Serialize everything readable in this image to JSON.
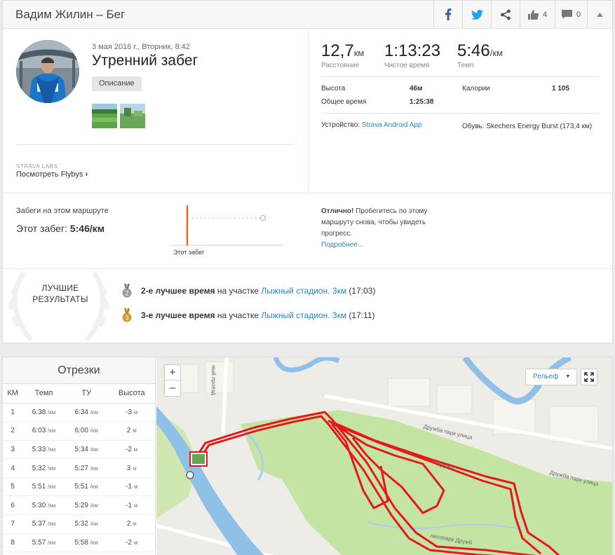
{
  "header": {
    "title": "Вадим Жилин – Бег",
    "kudos_count": "4",
    "comments_count": "0",
    "icons": [
      "facebook-icon",
      "twitter-icon",
      "share-icon",
      "thumbs-up-icon",
      "comment-icon",
      "chevron-up-icon"
    ]
  },
  "activity": {
    "date": "3 мая 2016 г., Вторник, 8:42",
    "title": "Утренний забег",
    "description_button": "Описание",
    "strava_labs": "STRAVA LABS",
    "flybys_link": "Посмотреть Flybys"
  },
  "stats": {
    "distance": {
      "value": "12,7",
      "unit": "км",
      "label": "Расстояние"
    },
    "moving_time": {
      "value": "1:13:23",
      "label": "Чистое время"
    },
    "pace": {
      "value": "5:46",
      "unit": "/км",
      "label": "Темп"
    },
    "elevation_label": "Высота",
    "elevation_value": "46м",
    "calories_label": "Калории",
    "calories_value": "1 105",
    "elapsed_label": "Общее время",
    "elapsed_value": "1:25:38",
    "device_label": "Устройство:",
    "device_value": "Strava Android App",
    "shoes_text": "Обувь: Skechers Energy Burst (173,4 км)"
  },
  "route_efforts": {
    "title": "Забеги на этом маршруте",
    "this_run_label": "Этот забег:",
    "this_run_value": "5:46/км",
    "chart_label": "Этот забег",
    "good_bold": "Отлично!",
    "good_text": " Пробегитесь по этому маршруту снова, чтобы увидеть прогресс.",
    "more_link": "Подробнее..."
  },
  "best_results": {
    "title": "ЛУЧШИЕ РЕЗУЛЬТАТЫ",
    "items": [
      {
        "place": "2",
        "bold": "2-е лучшее время",
        "middle": " на участке ",
        "segment": "Лыжный стадион. 3км",
        "time": " (17:03)",
        "medal_color": "#9a9a9a"
      },
      {
        "place": "3",
        "bold": "3-е лучшее время",
        "middle": " на участке ",
        "segment": "Лыжный стадион. 3км",
        "time": " (17:11)",
        "medal_color": "#d99a2b"
      }
    ]
  },
  "splits": {
    "title": "Отрезки",
    "columns": [
      "КМ",
      "Темп",
      "ТУ",
      "Высота"
    ],
    "rows": [
      {
        "km": "1",
        "pace": "6:38",
        "gap": "6:34",
        "elev": "-3",
        "unit": "/км",
        "elev_unit": "м"
      },
      {
        "km": "2",
        "pace": "6:03",
        "gap": "6:00",
        "elev": "2",
        "unit": "/км",
        "elev_unit": "м"
      },
      {
        "km": "3",
        "pace": "5:33",
        "gap": "5:34",
        "elev": "-2",
        "unit": "/км",
        "elev_unit": "м"
      },
      {
        "km": "4",
        "pace": "5:32",
        "gap": "5:27",
        "elev": "3",
        "unit": "/км",
        "elev_unit": "м"
      },
      {
        "km": "5",
        "pace": "5:51",
        "gap": "5:51",
        "elev": "-1",
        "unit": "/км",
        "elev_unit": "м"
      },
      {
        "km": "6",
        "pace": "5:30",
        "gap": "5:29",
        "elev": "-1",
        "unit": "/км",
        "elev_unit": "м"
      },
      {
        "km": "7",
        "pace": "5:37",
        "gap": "5:32",
        "elev": "2",
        "unit": "/км",
        "elev_unit": "м"
      },
      {
        "km": "8",
        "pace": "5:57",
        "gap": "5:58",
        "elev": "-2",
        "unit": "/км",
        "elev_unit": "м"
      }
    ]
  },
  "map": {
    "zoom_in": "+",
    "zoom_out": "–",
    "layer_select": "Рельеф",
    "street_1": "Дружба парк улица",
    "street_2": "Дружба парк улица",
    "street_3": "Дружб",
    "street_4": "лесопарк Дружб",
    "street_5": "ный проезд"
  },
  "colors": {
    "accent": "#fc4c02",
    "link": "#2a86b5",
    "route": "#e8161b",
    "river": "#8fc1e8",
    "park": "#c4e4a3"
  }
}
